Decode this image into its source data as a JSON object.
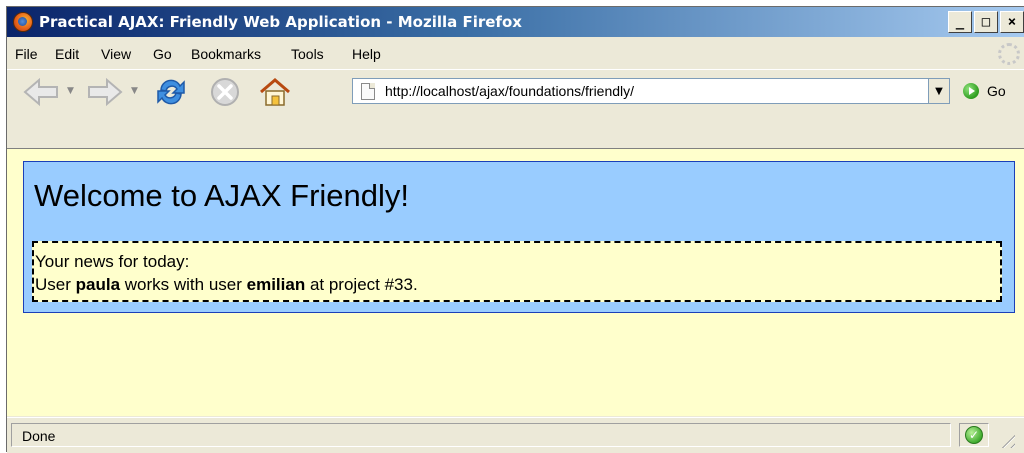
{
  "window": {
    "title": "Practical AJAX: Friendly Web Application - Mozilla Firefox",
    "buttons": {
      "minimize": "_",
      "maximize": "□",
      "close": "×"
    }
  },
  "menu": {
    "items": [
      {
        "label": "File"
      },
      {
        "label": "Edit"
      },
      {
        "label": "View"
      },
      {
        "label": "Go"
      },
      {
        "label": "Bookmarks"
      },
      {
        "label": "Tools"
      },
      {
        "label": "Help"
      }
    ]
  },
  "toolbar": {
    "icons": [
      "back-arrow-icon",
      "forward-arrow-icon",
      "reload-icon",
      "stop-icon",
      "home-icon"
    ],
    "url": "http://localhost/ajax/foundations/friendly/",
    "go_label": "Go"
  },
  "page": {
    "heading": "Welcome to AJAX Friendly!",
    "news": {
      "intro": "Your news for today:",
      "prefix": "User ",
      "user1": "paula",
      "middle": " works with user ",
      "user2": "emilian",
      "suffix": " at project #33."
    }
  },
  "status": {
    "text": "Done",
    "security_icon": "check-shield-icon"
  },
  "colors": {
    "content_bg": "#ffffcc",
    "welcome_bg": "#99ccff",
    "welcome_border": "#1a3fb8"
  }
}
